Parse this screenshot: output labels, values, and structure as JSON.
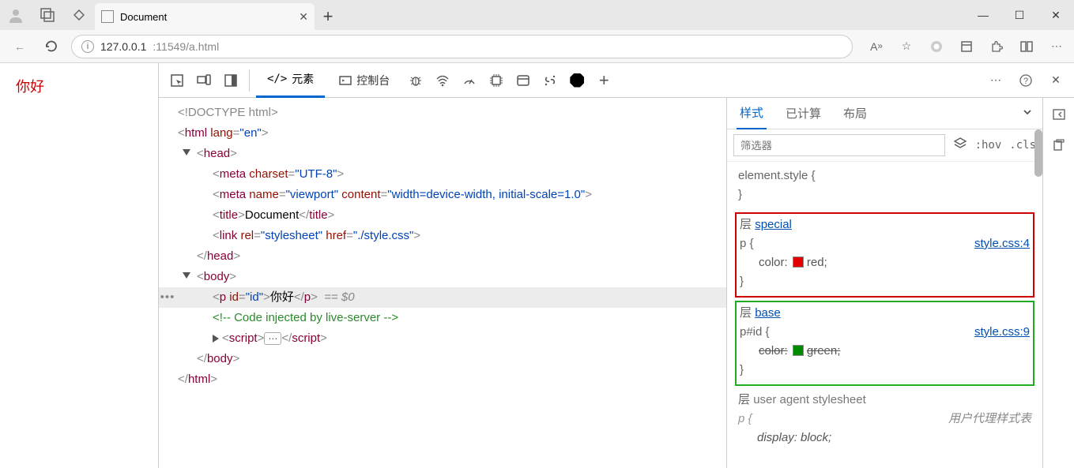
{
  "browser_top": {
    "tab_title": "Document"
  },
  "addr": {
    "host": "127.0.0.1",
    "port_path": ":11549/a.html"
  },
  "page": {
    "hello": "你好"
  },
  "devtools_tabs": {
    "elements": "元素",
    "console": "控制台"
  },
  "dom": {
    "doctype": "<!DOCTYPE html>",
    "html_open": "html",
    "lang_attr": "lang",
    "lang_val": "\"en\"",
    "head": "head",
    "meta1_c": "charset",
    "meta1_v": "\"UTF-8\"",
    "meta2_n": "name",
    "meta2_nv": "\"viewport\"",
    "meta2_c": "content",
    "meta2_cv": "\"width=device-width, initial-scale=1.0\"",
    "title_tag": "title",
    "title_txt": "Document",
    "link_rel": "rel",
    "link_relv": "\"stylesheet\"",
    "link_href": "href",
    "link_hrefv": "\"./style.css\"",
    "body": "body",
    "p_tag": "p",
    "p_id_attr": "id",
    "p_id_val": "\"id\"",
    "p_txt": "你好",
    "eq": "== $0",
    "comment": "<!-- Code injected by live-server -->",
    "script": "script",
    "gutter": "•••"
  },
  "styles": {
    "tab_style": "样式",
    "tab_computed": "已计算",
    "tab_layout": "布局",
    "filter_ph": "筛选器",
    "hov": ":hov",
    "cls": ".cls",
    "elem_style": "element.style",
    "brace_open": "{",
    "brace_close": "}",
    "layer_word": "层",
    "special": "special",
    "special_src": "style.css:4",
    "p_sel": "p",
    "color_prop": "color:",
    "red_val": "red;",
    "base": "base",
    "base_src": "style.css:9",
    "pid_sel": "p#id",
    "green_val": "green;",
    "ua_label": "user agent stylesheet",
    "ua_src": "用户代理样式表",
    "display_prop": "display:",
    "block_val": "block;"
  }
}
